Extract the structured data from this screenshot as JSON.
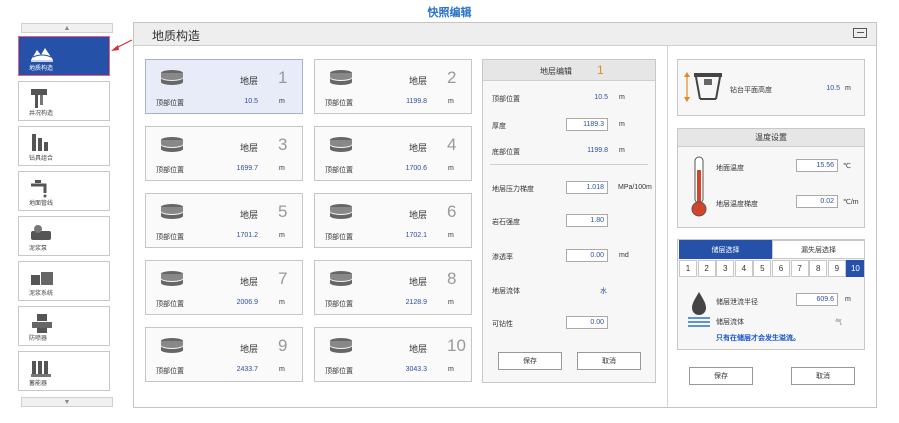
{
  "window_title": "快照编辑",
  "sidebar": {
    "items": [
      {
        "label": "地质构造",
        "icon": "geology-icon",
        "active": true
      },
      {
        "label": "井况构造",
        "icon": "well-structure-icon"
      },
      {
        "label": "钻具组合",
        "icon": "drill-assembly-icon"
      },
      {
        "label": "地面管线",
        "icon": "surface-pipeline-icon"
      },
      {
        "label": "泥浆泵",
        "icon": "mud-pump-icon"
      },
      {
        "label": "泥浆系统",
        "icon": "mud-system-icon"
      },
      {
        "label": "防喷器",
        "icon": "bop-icon"
      },
      {
        "label": "蓄能器",
        "icon": "accumulator-icon"
      }
    ]
  },
  "main": {
    "title": "地质构造"
  },
  "layers": {
    "layer_label": "地层",
    "pos_label": "顶部位置",
    "unit": "m",
    "cards": [
      {
        "num": "1",
        "value": "10.5"
      },
      {
        "num": "2",
        "value": "1199.8"
      },
      {
        "num": "3",
        "value": "1699.7"
      },
      {
        "num": "4",
        "value": "1700.6"
      },
      {
        "num": "5",
        "value": "1701.2"
      },
      {
        "num": "6",
        "value": "1702.1"
      },
      {
        "num": "7",
        "value": "2006.9"
      },
      {
        "num": "8",
        "value": "2128.9"
      },
      {
        "num": "9",
        "value": "2433.7"
      },
      {
        "num": "10",
        "value": "3043.3"
      }
    ]
  },
  "edit": {
    "title": "地层编辑",
    "num": "1",
    "top_label": "顶部位置",
    "top_value": "10.5",
    "top_unit": "m",
    "thick_label": "厚度",
    "thick_value": "1189.3",
    "thick_unit": "m",
    "bottom_label": "底部位置",
    "bottom_value": "1199.8",
    "bottom_unit": "m",
    "pressure_label": "地层压力梯度",
    "pressure_value": "1.018",
    "pressure_unit": "MPa/100m",
    "rock_label": "岩石强度",
    "rock_value": "1.80",
    "perm_label": "渗透率",
    "perm_value": "0.00",
    "perm_unit": "md",
    "fluid_label": "地层流体",
    "fluid_value": "水",
    "drill_label": "可钻性",
    "drill_value": "0.00",
    "save": "保存",
    "cancel": "取消"
  },
  "rig": {
    "label": "钻台平面高度",
    "value": "10.5",
    "unit": "m"
  },
  "temperature": {
    "title": "温度设置",
    "surface_label": "地面温度",
    "surface_value": "15.56",
    "surface_unit": "℃",
    "gradient_label": "地层温度梯度",
    "gradient_value": "0.02",
    "gradient_unit": "℃/m"
  },
  "reservoir": {
    "tab_select": "储层选择",
    "tab_leak": "漏失层选择",
    "numbers": [
      "1",
      "2",
      "3",
      "4",
      "5",
      "6",
      "7",
      "8",
      "9",
      "10"
    ],
    "selected": "10",
    "radius_label": "储层泄流半径",
    "radius_value": "609.6",
    "radius_unit": "m",
    "fluid_label": "储层流体",
    "fluid_value": "气",
    "note": "只有在储层才会发生溢流。"
  },
  "footer": {
    "save": "保存",
    "cancel": "取消"
  },
  "colors": {
    "accent": "#2551a8",
    "value_blue": "#2b4fa0",
    "orange": "#e08a1e",
    "title_blue": "#2b73c6"
  }
}
